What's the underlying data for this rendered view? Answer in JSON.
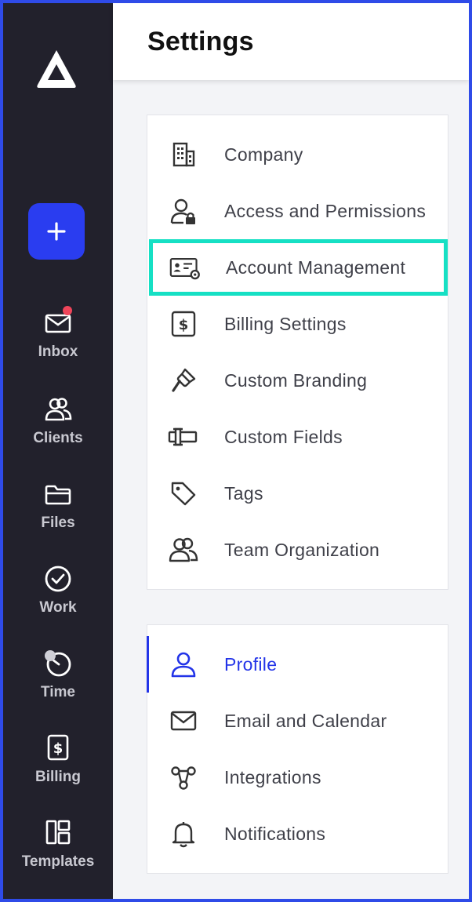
{
  "header": {
    "title": "Settings"
  },
  "sidebar": {
    "add_label": "+",
    "items": [
      {
        "label": "Inbox",
        "icon": "mail-icon",
        "has_notification": true
      },
      {
        "label": "Clients",
        "icon": "users-icon"
      },
      {
        "label": "Files",
        "icon": "folder-icon"
      },
      {
        "label": "Work",
        "icon": "check-circle-icon"
      },
      {
        "label": "Time",
        "icon": "timer-icon"
      },
      {
        "label": "Billing",
        "icon": "invoice-icon"
      },
      {
        "label": "Templates",
        "icon": "templates-icon"
      }
    ]
  },
  "settings_group": {
    "items": [
      {
        "label": "Company",
        "icon": "building-icon"
      },
      {
        "label": "Access and Permissions",
        "icon": "user-lock-icon"
      },
      {
        "label": "Account Management",
        "icon": "id-card-gear-icon",
        "highlighted": true
      },
      {
        "label": "Billing Settings",
        "icon": "dollar-doc-icon"
      },
      {
        "label": "Custom Branding",
        "icon": "brush-icon"
      },
      {
        "label": "Custom Fields",
        "icon": "text-field-icon"
      },
      {
        "label": "Tags",
        "icon": "tag-icon"
      },
      {
        "label": "Team Organization",
        "icon": "team-icon"
      }
    ]
  },
  "personal_group": {
    "items": [
      {
        "label": "Profile",
        "icon": "user-icon",
        "active": true
      },
      {
        "label": "Email and Calendar",
        "icon": "envelope-icon"
      },
      {
        "label": "Integrations",
        "icon": "share-nodes-icon"
      },
      {
        "label": "Notifications",
        "icon": "bell-icon"
      }
    ]
  },
  "colors": {
    "sidebar_bg": "#22212c",
    "accent": "#2334e8",
    "highlight": "#16e0c4",
    "notification": "#f0455a"
  }
}
